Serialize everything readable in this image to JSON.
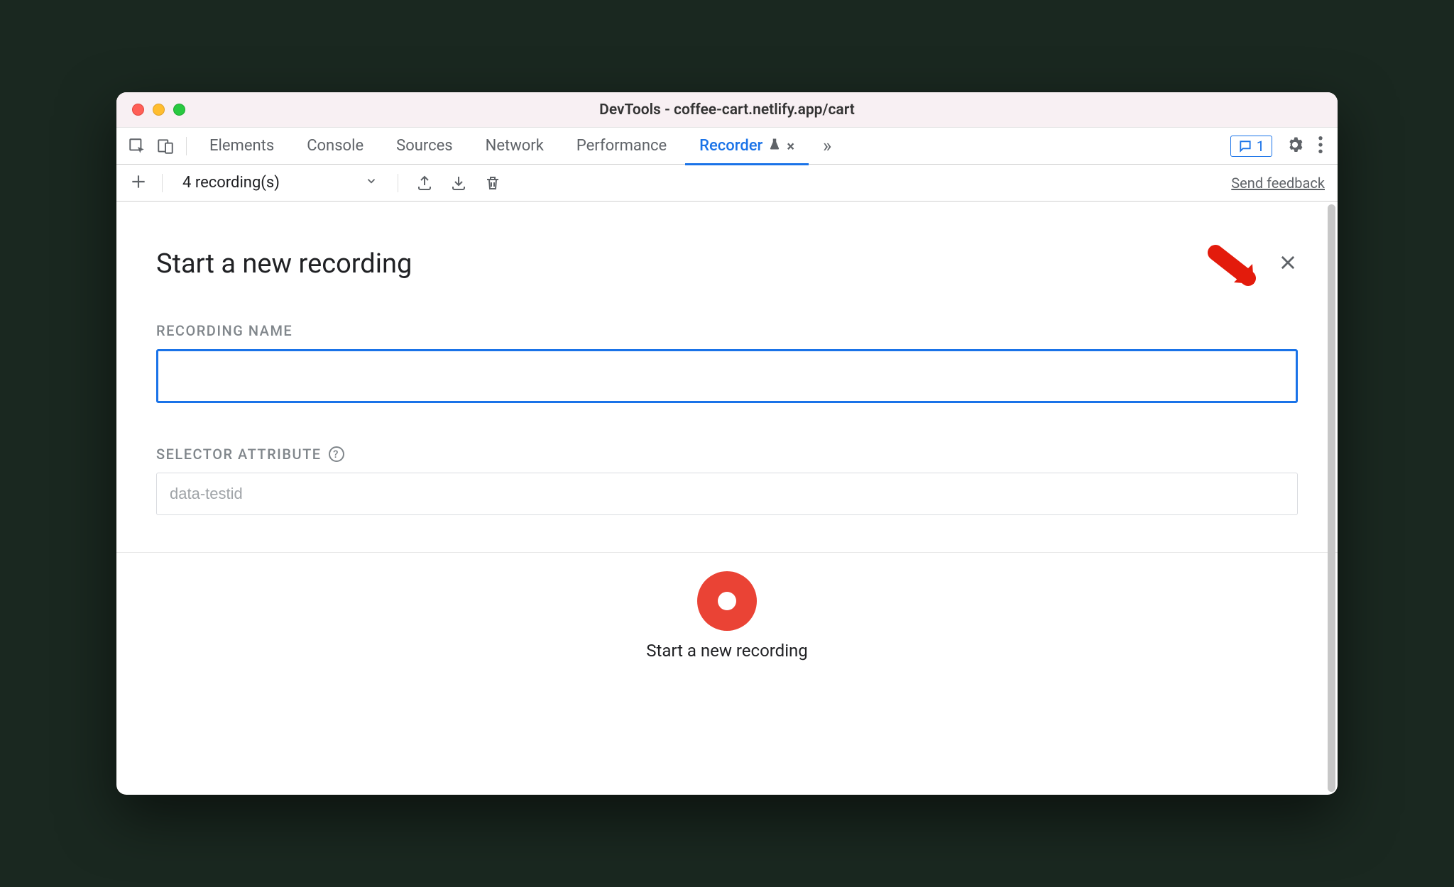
{
  "window": {
    "title": "DevTools - coffee-cart.netlify.app/cart"
  },
  "tabs": {
    "items": [
      "Elements",
      "Console",
      "Sources",
      "Network",
      "Performance",
      "Recorder"
    ],
    "active": "Recorder"
  },
  "issues": {
    "count": "1"
  },
  "toolbar": {
    "recordings_label": "4 recording(s)",
    "feedback_label": "Send feedback"
  },
  "panel": {
    "title": "Start a new recording",
    "recording_name_label": "RECORDING NAME",
    "recording_name_value": "",
    "selector_attr_label": "SELECTOR ATTRIBUTE",
    "selector_attr_placeholder": "data-testid",
    "start_label": "Start a new recording"
  },
  "colors": {
    "accent": "#1a73e8",
    "record": "#ea4335"
  }
}
